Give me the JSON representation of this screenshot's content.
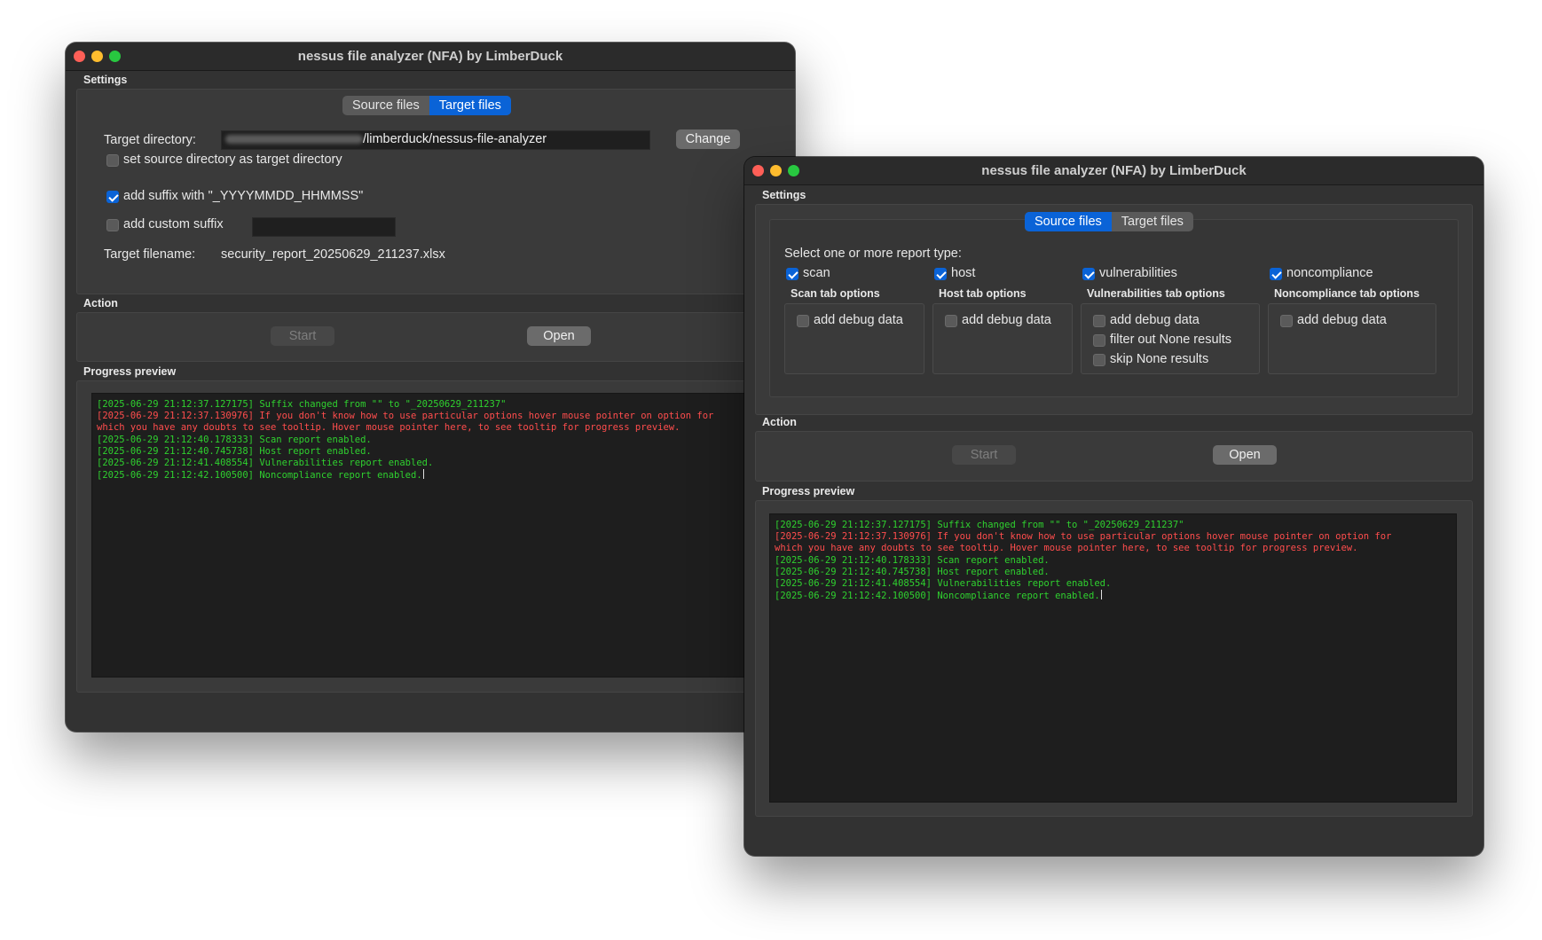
{
  "colors": {
    "accent": "#0a63d7",
    "log_green": "#2fd12f",
    "log_red": "#ff4d4d",
    "window_bg": "#323232"
  },
  "windows": [
    {
      "title": "nessus file analyzer (NFA) by LimberDuck",
      "settings_label": "Settings",
      "tabs": [
        "Source files",
        "Target files"
      ],
      "active_tab": "Target files",
      "target": {
        "directory_label": "Target directory:",
        "directory_value_visible": "/limberduck/nessus-file-analyzer",
        "change_button": "Change",
        "source_as_target_label": "set source directory as target directory",
        "add_suffix_label": "add suffix with \"_YYYYMMDD_HHMMSS\"",
        "add_custom_suffix_label": "add custom suffix",
        "filename_label": "Target filename:",
        "filename_value": "security_report_20250629_211237.xlsx"
      },
      "action_label": "Action",
      "start_button": "Start",
      "open_button": "Open",
      "progress_label": "Progress preview"
    },
    {
      "title": "nessus file analyzer (NFA) by LimberDuck",
      "settings_label": "Settings",
      "tabs": [
        "Source files",
        "Target files"
      ],
      "active_tab": "Source files",
      "report_type_prompt": "Select one or more report type:",
      "report_types": [
        {
          "label": "scan",
          "checked": true,
          "options_title": "Scan tab options",
          "options": [
            "add debug data"
          ]
        },
        {
          "label": "host",
          "checked": true,
          "options_title": "Host tab options",
          "options": [
            "add debug data"
          ]
        },
        {
          "label": "vulnerabilities",
          "checked": true,
          "options_title": "Vulnerabilities tab options",
          "options": [
            "add debug data",
            "filter out None results",
            "skip None results"
          ]
        },
        {
          "label": "noncompliance",
          "checked": true,
          "options_title": "Noncompliance tab options",
          "options": [
            "add debug data"
          ]
        }
      ],
      "action_label": "Action",
      "start_button": "Start",
      "open_button": "Open",
      "progress_label": "Progress preview"
    }
  ],
  "log_lines": [
    {
      "color": "green",
      "text": "[2025-06-29 21:12:37.127175] Suffix changed from \"\" to \"_20250629_211237\""
    },
    {
      "color": "red",
      "text": "[2025-06-29 21:12:37.130976] If you don't know how to use particular options hover mouse pointer on option for"
    },
    {
      "color": "red",
      "text": "which you have any doubts to see tooltip. Hover mouse pointer here, to see tooltip for progress preview."
    },
    {
      "color": "green",
      "text": "[2025-06-29 21:12:40.178333] Scan report enabled."
    },
    {
      "color": "green",
      "text": "[2025-06-29 21:12:40.745738] Host report enabled."
    },
    {
      "color": "green",
      "text": "[2025-06-29 21:12:41.408554] Vulnerabilities report enabled."
    },
    {
      "color": "green",
      "text": "[2025-06-29 21:12:42.100500] Noncompliance report enabled."
    }
  ]
}
